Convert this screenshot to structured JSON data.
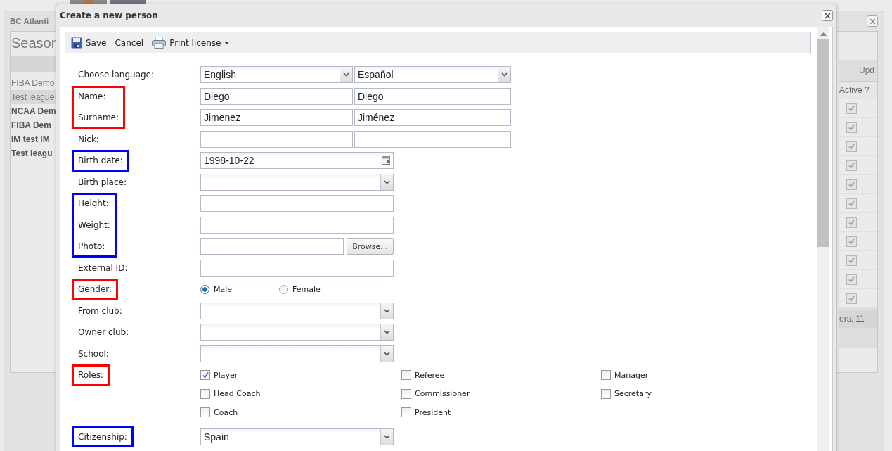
{
  "background_window": {
    "title": "BC Atlanti",
    "heading": "Season",
    "list_items": [
      {
        "label": "FIBA Demo",
        "bold": false,
        "selected": false
      },
      {
        "label": "Test league",
        "bold": false,
        "selected": true
      },
      {
        "label": "NCAA Dem",
        "bold": true,
        "selected": false
      },
      {
        "label": "FIBA Dem",
        "bold": true,
        "selected": false
      },
      {
        "label": "IM test IM",
        "bold": true,
        "selected": false
      },
      {
        "label": "Test leagu",
        "bold": true,
        "selected": false
      }
    ],
    "toolbar_label": "Upd",
    "column_header": "Active ?",
    "active_rows": [
      {
        "checked": true
      },
      {
        "checked": true
      },
      {
        "checked": true
      },
      {
        "checked": true
      },
      {
        "checked": true
      },
      {
        "checked": true
      },
      {
        "checked": true
      },
      {
        "checked": true
      },
      {
        "checked": true
      },
      {
        "checked": true
      },
      {
        "checked": true
      }
    ],
    "footer": "ers: 11"
  },
  "dialog": {
    "title": "Create a new person",
    "toolbar": [
      {
        "kind": "save",
        "label": "Save"
      },
      {
        "kind": "cancel",
        "label": "Cancel"
      },
      {
        "kind": "print",
        "label": "Print license",
        "dropdown": true
      }
    ],
    "groups": [
      {
        "fields": [
          {
            "label": "Choose language:",
            "kind": "dual-select",
            "values": [
              "English",
              "Español"
            ]
          }
        ]
      },
      {
        "color": "#ff0000",
        "fields": [
          {
            "label": "Name:",
            "kind": "dual-text",
            "values": [
              "Diego",
              "Diego"
            ]
          },
          {
            "label": "Surname:",
            "kind": "dual-text",
            "values": [
              "Jimenez",
              "Jiménez"
            ]
          }
        ]
      },
      {
        "fields": [
          {
            "label": "Nick:",
            "kind": "dual-text"
          }
        ]
      },
      {
        "color": "#0000ff",
        "fields": [
          {
            "label": "Birth date:",
            "kind": "date",
            "value": "1998-10-22"
          }
        ]
      },
      {
        "fields": [
          {
            "label": "Birth place:",
            "kind": "select"
          }
        ]
      },
      {
        "color": "#0000ff",
        "fields": [
          {
            "label": "Height:",
            "kind": "text"
          },
          {
            "label": "Weight:",
            "kind": "text"
          },
          {
            "label": "Photo:",
            "kind": "file",
            "button": "Browse..."
          }
        ]
      },
      {
        "fields": [
          {
            "label": "External ID:",
            "kind": "text"
          }
        ]
      },
      {
        "color": "#ff0000",
        "fields": [
          {
            "label": "Gender:",
            "kind": "radio",
            "options": [
              {
                "label": "Male",
                "selected": true
              },
              {
                "label": "Female",
                "selected": false
              }
            ]
          }
        ]
      },
      {
        "fields": [
          {
            "label": "From club:",
            "kind": "select"
          },
          {
            "label": "Owner club:",
            "kind": "select"
          },
          {
            "label": "School:",
            "kind": "select"
          }
        ]
      },
      {
        "color": "#ff0000",
        "fields": [
          {
            "label": "Roles:",
            "kind": "checkboxes",
            "options": [
              {
                "label": "Player",
                "checked": true
              },
              {
                "label": "Referee",
                "checked": false
              },
              {
                "label": "Manager",
                "checked": false
              },
              {
                "label": "Head Coach",
                "checked": false
              },
              {
                "label": "Commissioner",
                "checked": false
              },
              {
                "label": "Secretary",
                "checked": false
              },
              {
                "label": "Coach",
                "checked": false
              },
              {
                "label": "President",
                "checked": false
              }
            ]
          }
        ]
      },
      {
        "color": "#0000ff",
        "fields": [
          {
            "label": "Citizenship:",
            "kind": "select",
            "value": "Spain"
          }
        ]
      }
    ]
  }
}
